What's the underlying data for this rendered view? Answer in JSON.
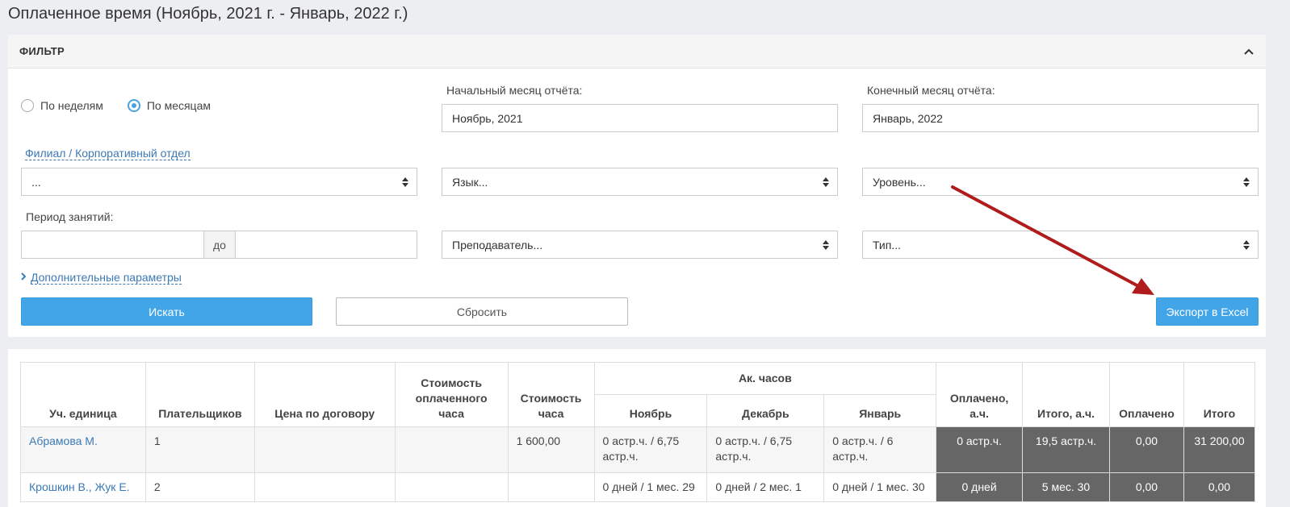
{
  "page": {
    "title": "Оплаченное время (Ноябрь, 2021 г. - Январь, 2022 г.)"
  },
  "filter": {
    "title": "ФИЛЬТР",
    "radio_week": "По неделям",
    "radio_month": "По месяцам",
    "start_month_label": "Начальный месяц отчёта:",
    "start_month_value": "Ноябрь, 2021",
    "end_month_label": "Конечный месяц отчёта:",
    "end_month_value": "Январь, 2022",
    "branch_label": "Филиал / Корпоративный отдел",
    "branch_value": "...",
    "language_value": "Язык...",
    "level_value": "Уровень...",
    "period_label": "Период занятий:",
    "period_to": "до",
    "teacher_value": "Преподаватель...",
    "type_value": "Тип...",
    "more_params": "Дополнительные параметры",
    "search_button": "Искать",
    "reset_button": "Сбросить",
    "export_button": "Экспорт в Excel"
  },
  "table": {
    "headers": {
      "unit": "Уч. единица",
      "payers": "Плательщиков",
      "contract_price": "Цена по договору",
      "paid_hour_cost": "Стоимость оплаченного часа",
      "hour_cost": "Стоимость часа",
      "ac_hours": "Ак. часов",
      "november": "Ноябрь",
      "december": "Декабрь",
      "january": "Январь",
      "paid_ah": "Оплачено, а.ч.",
      "total_ah": "Итого, а.ч.",
      "paid": "Оплачено",
      "total": "Итого"
    },
    "rows": [
      {
        "unit": "Абрамова М.",
        "payers": "1",
        "contract_price": "",
        "paid_hour_cost": "",
        "hour_cost": "1 600,00",
        "november": "0 астр.ч. / 6,75 астр.ч.",
        "december": "0 астр.ч. / 6,75 астр.ч.",
        "january": "0 астр.ч. / 6 астр.ч.",
        "paid_ah": "0 астр.ч.",
        "total_ah": "19,5 астр.ч.",
        "paid": "0,00",
        "total": "31 200,00"
      },
      {
        "unit": "Крошкин В., Жук Е.",
        "payers": "2",
        "contract_price": "",
        "paid_hour_cost": "",
        "hour_cost": "",
        "november": "0 дней / 1 мес. 29",
        "december": "0 дней / 2 мес. 1",
        "january": "0 дней / 1 мес. 30",
        "paid_ah": "0 дней",
        "total_ah": "5 мес. 30",
        "paid": "0,00",
        "total": "0,00"
      }
    ]
  },
  "colors": {
    "accent": "#42a5e8",
    "link": "#3c7ab5",
    "dark_cell": "#666666",
    "arrow": "#b01c1c"
  }
}
